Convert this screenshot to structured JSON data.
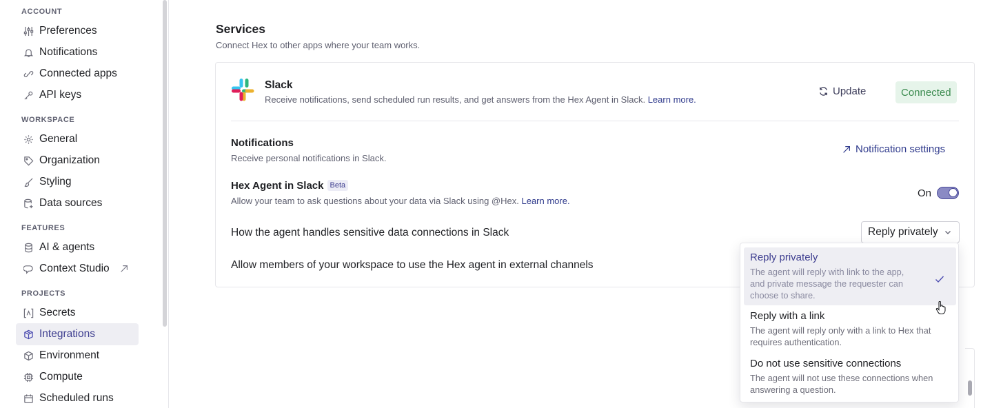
{
  "sidebar": {
    "sections": {
      "account": "ACCOUNT",
      "workspace": "WORKSPACE",
      "features": "FEATURES",
      "projects": "PROJECTS"
    },
    "items": {
      "preferences": {
        "label": "Preferences",
        "icon": "sliders-icon"
      },
      "notifications": {
        "label": "Notifications",
        "icon": "bell-icon"
      },
      "connected_apps": {
        "label": "Connected apps",
        "icon": "link-icon"
      },
      "api_keys": {
        "label": "API keys",
        "icon": "key-icon"
      },
      "general": {
        "label": "General",
        "icon": "gear-icon"
      },
      "organization": {
        "label": "Organization",
        "icon": "tag-icon"
      },
      "styling": {
        "label": "Styling",
        "icon": "brush-icon"
      },
      "data_sources": {
        "label": "Data sources",
        "icon": "database-plus-icon"
      },
      "ai_agents": {
        "label": "AI & agents",
        "icon": "database-icon"
      },
      "context_studio": {
        "label": "Context Studio",
        "icon": "context-icon"
      },
      "secrets": {
        "label": "Secrets",
        "icon": "secret-icon"
      },
      "integrations": {
        "label": "Integrations",
        "icon": "cube-icon",
        "active": true
      },
      "environment": {
        "label": "Environment",
        "icon": "box-icon"
      },
      "compute": {
        "label": "Compute",
        "icon": "chip-icon"
      },
      "scheduled_runs": {
        "label": "Scheduled runs",
        "icon": "calendar-icon"
      }
    }
  },
  "main": {
    "title": "Services",
    "subtitle": "Connect Hex to other apps where your team works.",
    "slack": {
      "name": "Slack",
      "description": "Receive notifications, send scheduled run results, and get answers from the Hex Agent in Slack.",
      "learn_more": "Learn more.",
      "update_label": "Update",
      "status": "Connected"
    },
    "notifications": {
      "title": "Notifications",
      "subtitle": "Receive personal notifications in Slack.",
      "settings_link": "Notification settings"
    },
    "agent": {
      "title": "Hex Agent in Slack",
      "badge": "Beta",
      "subtitle": "Allow your team to ask questions about your data via Slack using @Hex.",
      "learn_more": "Learn more.",
      "toggle_label": "On",
      "toggle_on": true
    },
    "sensitive": {
      "label": "How the agent handles sensitive data connections in Slack",
      "selected": "Reply privately"
    },
    "external": {
      "label": "Allow members of your workspace to use the Hex agent in external channels"
    },
    "dropdown_options": [
      {
        "label": "Reply privately",
        "description": "The agent will reply with link to the app, and private message the requester can choose to share.",
        "selected": true
      },
      {
        "label": "Reply with a link",
        "description": "The agent will reply only with a link to Hex that requires authentication.",
        "selected": false
      },
      {
        "label": "Do not use sensitive connections",
        "description": "The agent will not use these connections when answering a question.",
        "selected": false
      }
    ]
  },
  "colors": {
    "accent": "#3d3d8f",
    "connected_bg": "#e6f4ea",
    "connected_text": "#3a8a4e",
    "slack_blue": "#36c5f0",
    "slack_green": "#2eb67d",
    "slack_red": "#e01e5a",
    "slack_yellow": "#ecb22e"
  }
}
